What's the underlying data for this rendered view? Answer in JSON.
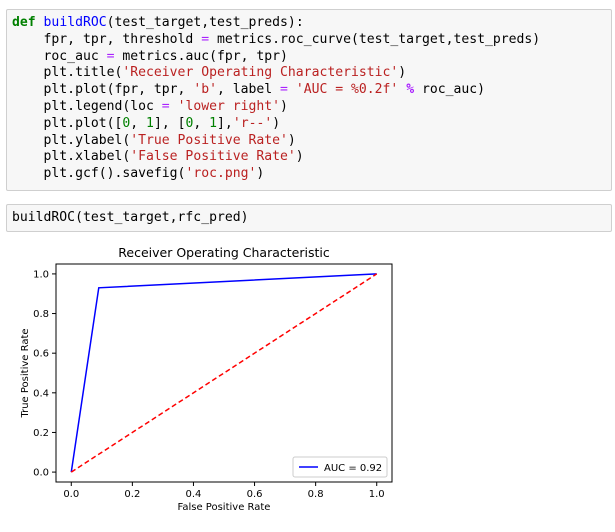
{
  "cells": [
    {
      "lines": [
        [
          {
            "t": "def",
            "c": "kw"
          },
          {
            "t": " "
          },
          {
            "t": "buildROC",
            "c": "fn"
          },
          {
            "t": "(test_target,test_preds):"
          }
        ],
        [
          {
            "t": "    fpr, tpr, threshold "
          },
          {
            "t": "=",
            "c": "op"
          },
          {
            "t": " metrics.roc_curve(test_target,test_preds)"
          }
        ],
        [
          {
            "t": "    roc_auc "
          },
          {
            "t": "=",
            "c": "op"
          },
          {
            "t": " metrics.auc(fpr, tpr)"
          }
        ],
        [
          {
            "t": "    plt.title("
          },
          {
            "t": "'Receiver Operating Characteristic'",
            "c": "st"
          },
          {
            "t": ")"
          }
        ],
        [
          {
            "t": "    plt.plot(fpr, tpr, "
          },
          {
            "t": "'b'",
            "c": "st"
          },
          {
            "t": ", label "
          },
          {
            "t": "=",
            "c": "op"
          },
          {
            "t": " "
          },
          {
            "t": "'AUC = %0.2f'",
            "c": "st"
          },
          {
            "t": " "
          },
          {
            "t": "%",
            "c": "bop"
          },
          {
            "t": " roc_auc)"
          }
        ],
        [
          {
            "t": "    plt.legend(loc "
          },
          {
            "t": "=",
            "c": "op"
          },
          {
            "t": " "
          },
          {
            "t": "'lower right'",
            "c": "st"
          },
          {
            "t": ")"
          }
        ],
        [
          {
            "t": "    plt.plot(["
          },
          {
            "t": "0",
            "c": "num"
          },
          {
            "t": ", "
          },
          {
            "t": "1",
            "c": "num"
          },
          {
            "t": "], ["
          },
          {
            "t": "0",
            "c": "num"
          },
          {
            "t": ", "
          },
          {
            "t": "1",
            "c": "num"
          },
          {
            "t": "],"
          },
          {
            "t": "'r--'",
            "c": "st"
          },
          {
            "t": ")"
          }
        ],
        [
          {
            "t": "    plt.ylabel("
          },
          {
            "t": "'True Positive Rate'",
            "c": "st"
          },
          {
            "t": ")"
          }
        ],
        [
          {
            "t": "    plt.xlabel("
          },
          {
            "t": "'False Positive Rate'",
            "c": "st"
          },
          {
            "t": ")"
          }
        ],
        [
          {
            "t": "    plt.gcf().savefig("
          },
          {
            "t": "'roc.png'",
            "c": "st"
          },
          {
            "t": ")"
          }
        ]
      ]
    },
    {
      "lines": [
        [
          {
            "t": "buildROC(test_target,rfc_pred)"
          }
        ]
      ]
    }
  ],
  "chart_data": {
    "type": "line",
    "title": "Receiver Operating Characteristic",
    "xlabel": "False Positive Rate",
    "ylabel": "True Positive Rate",
    "xlim": [
      -0.05,
      1.05
    ],
    "ylim": [
      -0.05,
      1.05
    ],
    "xticks": [
      "0.0",
      "0.2",
      "0.4",
      "0.6",
      "0.8",
      "1.0"
    ],
    "yticks": [
      "0.0",
      "0.2",
      "0.4",
      "0.6",
      "0.8",
      "1.0"
    ],
    "xtick_values": [
      0,
      0.2,
      0.4,
      0.6,
      0.8,
      1.0
    ],
    "ytick_values": [
      0,
      0.2,
      0.4,
      0.6,
      0.8,
      1.0
    ],
    "grid": false,
    "legend_placement": "lower right",
    "series": [
      {
        "name": "AUC = 0.92",
        "x": [
          0,
          0.09,
          1.0
        ],
        "y": [
          0,
          0.93,
          1.0
        ],
        "color": "#0000ff",
        "style": "solid"
      },
      {
        "x": [
          0,
          1
        ],
        "y": [
          0,
          1
        ],
        "color": "#ff0000",
        "style": "dashed"
      }
    ]
  }
}
